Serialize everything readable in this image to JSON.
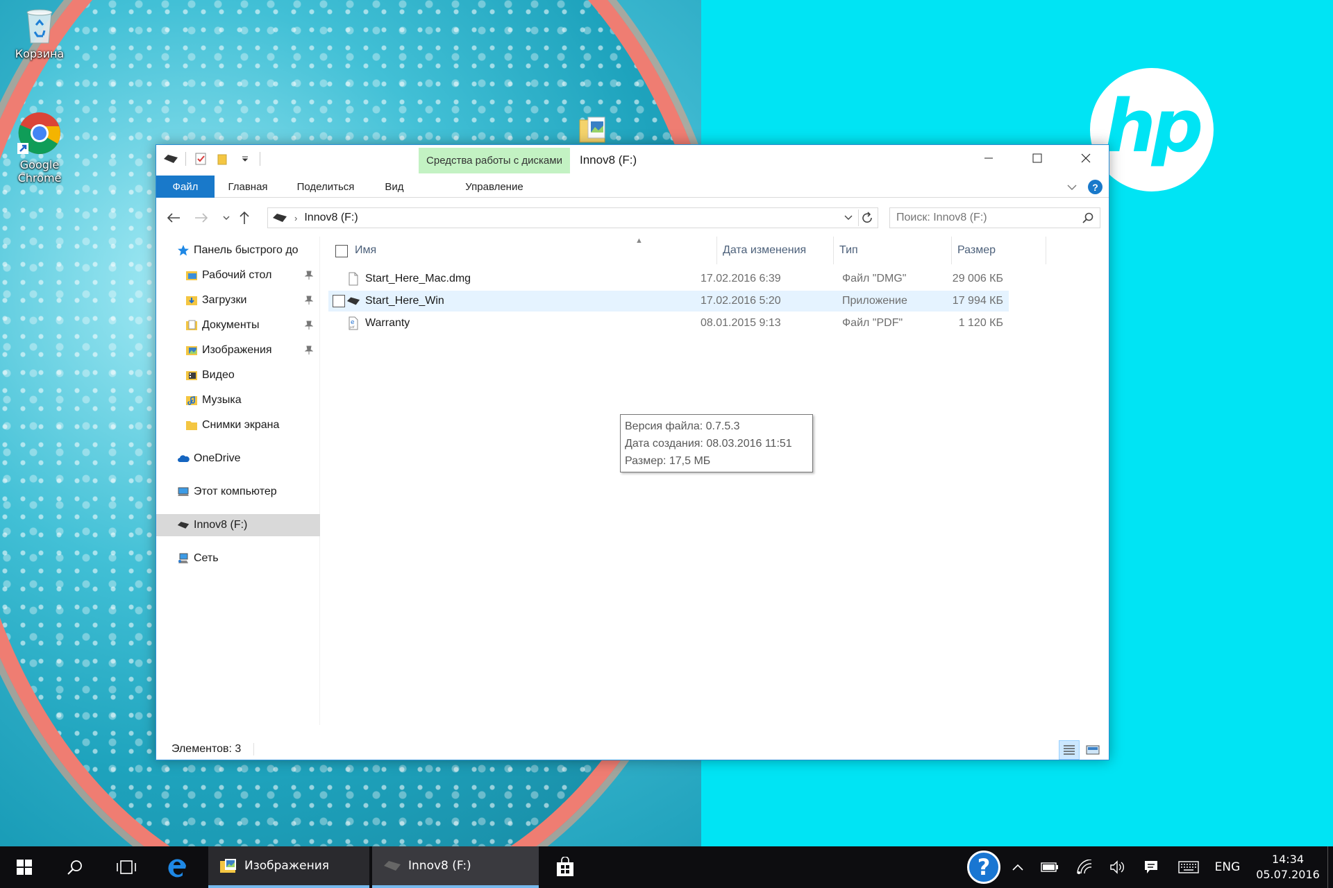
{
  "desktop": {
    "icons": [
      {
        "label": "Корзина"
      },
      {
        "label": "Google\nChrome"
      }
    ],
    "brand_color": "#00e4f4"
  },
  "window": {
    "title": "Innov8 (F:)",
    "contextual_group": "Средства работы с дисками",
    "tabs": {
      "file": "Файл",
      "home": "Главная",
      "share": "Поделиться",
      "view": "Вид",
      "manage": "Управление"
    },
    "help_label": "?",
    "accent_color": "#1979ca",
    "address": {
      "path": "Innov8 (F:)"
    },
    "search": {
      "placeholder": "Поиск: Innov8 (F:)"
    },
    "nav_pane": {
      "quick_access": "Панель быстрого до",
      "items": [
        {
          "label": "Рабочий стол",
          "icon": "desktop-folder-icon",
          "pinned": true
        },
        {
          "label": "Загрузки",
          "icon": "downloads-folder-icon",
          "pinned": true
        },
        {
          "label": "Документы",
          "icon": "documents-folder-icon",
          "pinned": true
        },
        {
          "label": "Изображения",
          "icon": "pictures-folder-icon",
          "pinned": true
        },
        {
          "label": "Видео",
          "icon": "videos-folder-icon",
          "pinned": false
        },
        {
          "label": "Музыка",
          "icon": "music-folder-icon",
          "pinned": false
        },
        {
          "label": "Снимки экрана",
          "icon": "folder-icon",
          "pinned": false
        }
      ],
      "onedrive": "OneDrive",
      "this_pc": "Этот компьютер",
      "drive": "Innov8 (F:)",
      "network": "Сеть"
    },
    "columns": {
      "name": "Имя",
      "date": "Дата изменения",
      "type": "Тип",
      "size": "Размер"
    },
    "files": [
      {
        "name": "Start_Here_Mac.dmg",
        "date": "17.02.2016 6:39",
        "type": "Файл \"DMG\"",
        "size": "29 006 КБ"
      },
      {
        "name": "Start_Here_Win",
        "date": "17.02.2016 5:20",
        "type": "Приложение",
        "size": "17 994 КБ"
      },
      {
        "name": "Warranty",
        "date": "08.01.2015 9:13",
        "type": "Файл \"PDF\"",
        "size": "1 120 КБ"
      }
    ],
    "tooltip": {
      "line1": "Версия файла: 0.7.5.3",
      "line2": "Дата создания: 08.03.2016 11:51",
      "line3": "Размер: 17,5 МБ"
    },
    "status": "Элементов: 3"
  },
  "taskbar": {
    "apps": [
      {
        "label": "Изображения"
      },
      {
        "label": "Innov8 (F:)"
      }
    ],
    "language": "ENG",
    "time": "14:34",
    "date": "05.07.2016"
  }
}
